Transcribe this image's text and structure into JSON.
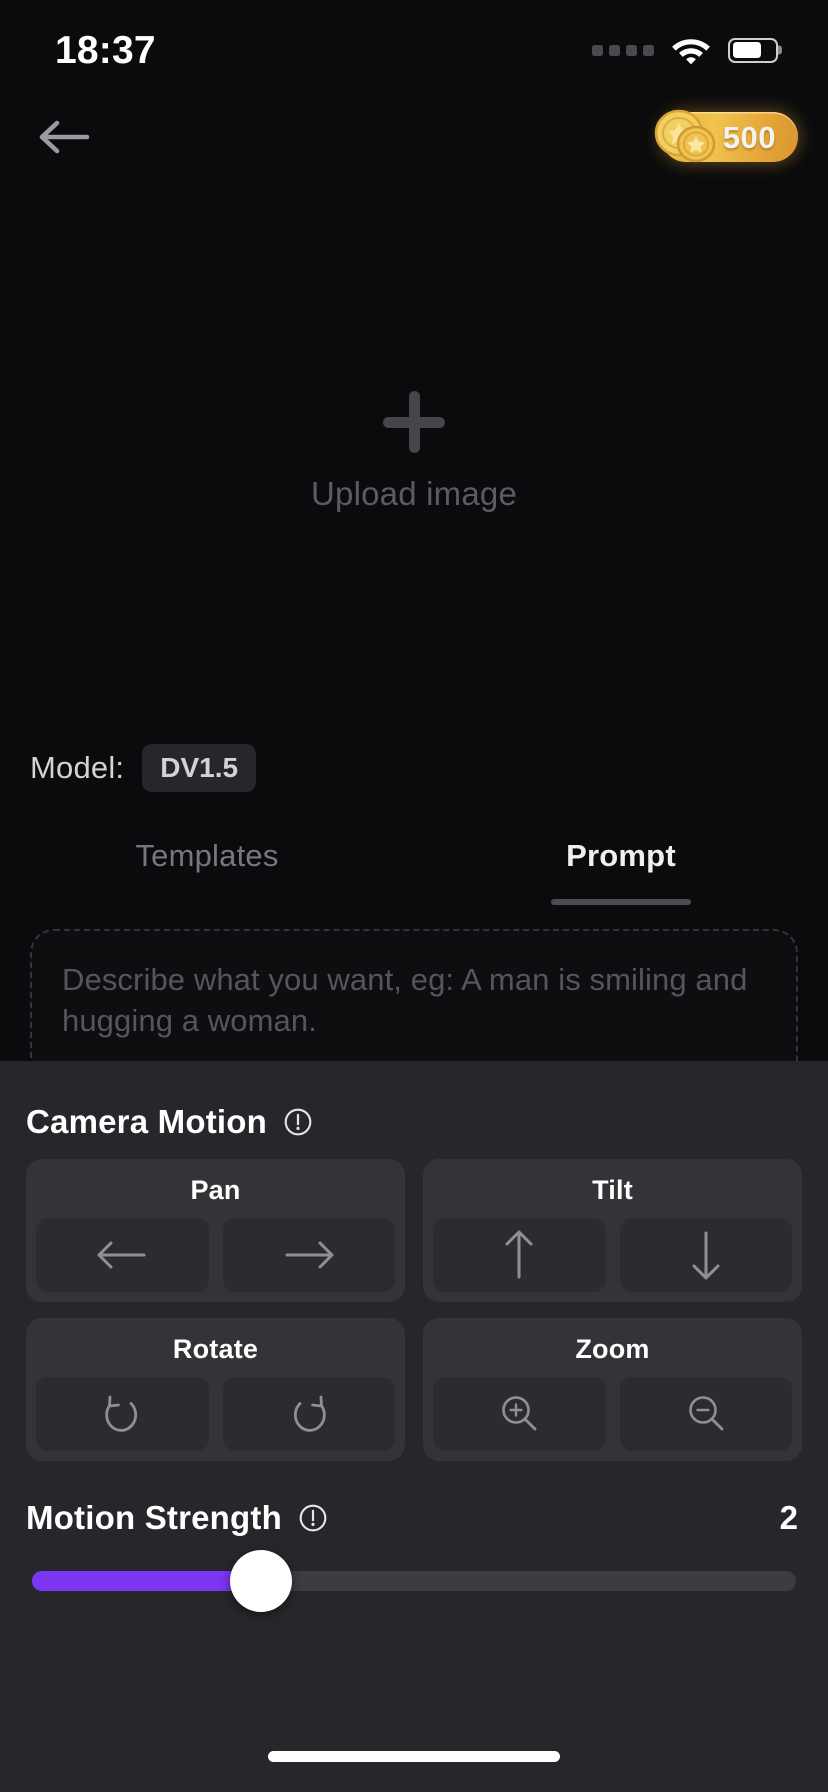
{
  "status_bar": {
    "time": "18:37",
    "signal_icon": "signal-dots-icon",
    "wifi_icon": "wifi-icon",
    "battery_icon": "battery-icon",
    "battery_level_percent": 70
  },
  "nav": {
    "back_icon": "arrow-left-icon",
    "coin_icon": "coin-stack-icon",
    "coin_balance": "500"
  },
  "upload": {
    "plus_icon": "plus-icon",
    "label": "Upload image"
  },
  "model": {
    "label": "Model:",
    "value": "DV1.5"
  },
  "tabs": [
    {
      "label": "Templates",
      "active": false
    },
    {
      "label": "Prompt",
      "active": true
    }
  ],
  "prompt": {
    "placeholder": "Describe what you want,  eg: A man is smiling and hugging a woman.",
    "value": ""
  },
  "camera_motion": {
    "title": "Camera Motion",
    "info_icon": "info-circle-icon",
    "groups": [
      {
        "title": "Pan",
        "buttons": [
          {
            "icon": "arrow-left-icon"
          },
          {
            "icon": "arrow-right-icon"
          }
        ]
      },
      {
        "title": "Tilt",
        "buttons": [
          {
            "icon": "arrow-up-icon"
          },
          {
            "icon": "arrow-down-icon"
          }
        ]
      },
      {
        "title": "Rotate",
        "buttons": [
          {
            "icon": "rotate-counterclockwise-icon"
          },
          {
            "icon": "rotate-clockwise-icon"
          }
        ]
      },
      {
        "title": "Zoom",
        "buttons": [
          {
            "icon": "zoom-in-icon"
          },
          {
            "icon": "zoom-out-icon"
          }
        ]
      }
    ]
  },
  "motion_strength": {
    "title": "Motion Strength",
    "info_icon": "info-circle-icon",
    "value": "2",
    "fill_percent": 30,
    "accent_color": "#7c35f0",
    "track_color": "#3c3c41"
  },
  "home_indicator": {
    "name": "home-indicator"
  }
}
